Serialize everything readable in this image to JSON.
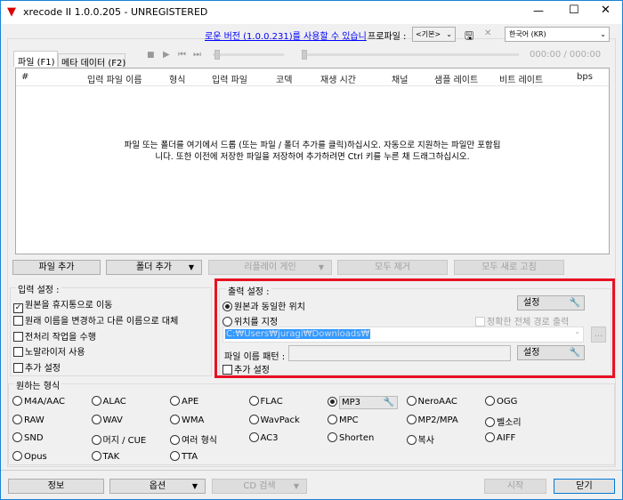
{
  "window": {
    "title": "xrecode II 1.0.0.205 - UNREGISTERED",
    "minimize": "—",
    "maximize": "☐",
    "close": "✕"
  },
  "header": {
    "update_link": "로운 버전 (1.0.0.231)를 사용할 수 있습니",
    "profile_label": "프로파일 :",
    "profile_value": "<기본>",
    "language_value": "한국어 (KR)",
    "delete": "✕",
    "time": "000:00 / 000:00"
  },
  "tabs": [
    {
      "label": "파일 (F1)",
      "active": true
    },
    {
      "label": "메타 데이터 (F2)",
      "active": false
    }
  ],
  "list": {
    "columns": [
      "#",
      "입력 파일 이름",
      "형식",
      "입력 파일",
      "코덱",
      "재생 시간",
      "채널",
      "샘플 레이트",
      "비트 레이트",
      "bps"
    ],
    "empty_line1": "파일 또는 폴더를 여기에서 드롭 (또는 파일 / 폴더 추가를 클릭)하십시오. 자동으로 지원하는 파일만 포함됩",
    "empty_line2": "니다. 또한 이전에 저장한 파일을 저장하여 추가하려면 Ctrl 키를 누른 채 드래그하십시오."
  },
  "actions": {
    "add_file": "파일 추가",
    "add_folder": "폴더 추가",
    "replay_gain": "리플레이 게인",
    "remove_all": "모두 제거",
    "refresh_all": "모두 새로 고침"
  },
  "input_settings": {
    "label": "입력 설정 :",
    "items": [
      {
        "label": "원본을 휴지통으로 이동",
        "checked": true
      },
      {
        "label": "원래 이름을 변경하고 다른 이름으로 대체",
        "checked": false
      },
      {
        "label": "전처리 작업을 수행",
        "checked": false
      },
      {
        "label": "노말라이저 사용",
        "checked": false
      },
      {
        "label": "추가 설정",
        "checked": false
      }
    ]
  },
  "output_settings": {
    "label": "출력 설정 :",
    "same_location": "원본과 동일한 위치",
    "specify_location": "위치를 지정",
    "settings": "설정",
    "full_path": "정확한 전체 경로 출력",
    "path": "C:₩Users₩juragi₩Downloads₩",
    "browse": "...",
    "pattern_label": "파일 이름 패턴 :",
    "pattern_value": "",
    "extra": "추가 설정",
    "selected": "same_location",
    "highlight_color": "#e81123"
  },
  "formats": {
    "label": "원하는 형식",
    "selected": "MP3",
    "rows": [
      [
        "M4A/AAC",
        "ALAC",
        "APE",
        "FLAC",
        "MP3",
        "NeroAAC",
        "OGG"
      ],
      [
        "RAW",
        "WAV",
        "WMA",
        "WavPack",
        "MPC",
        "MP2/MPA",
        "벨소리"
      ],
      [
        "SND",
        "머지 / CUE",
        "여러 형식",
        "AC3",
        "Shorten",
        "복사",
        "AIFF"
      ],
      [
        "Opus",
        "TAK",
        "TTA"
      ]
    ]
  },
  "footer": {
    "info": "정보",
    "options": "옵션",
    "cd_search": "CD 검색",
    "start": "시작",
    "close": "닫기"
  }
}
